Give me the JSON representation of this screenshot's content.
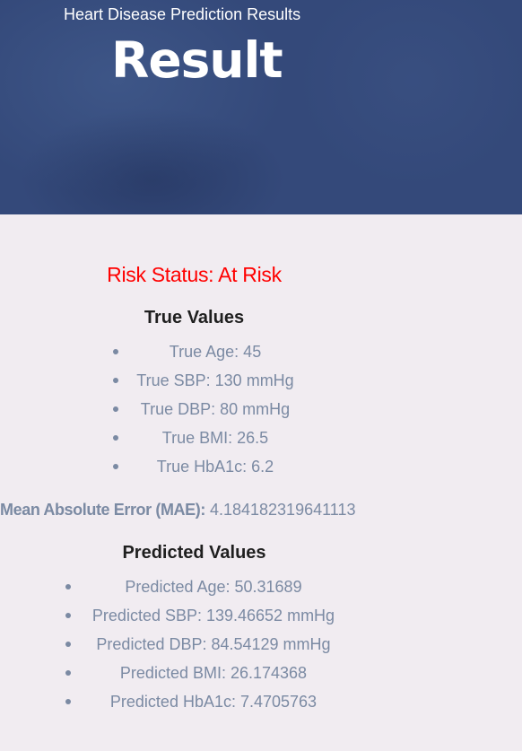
{
  "header": {
    "subtitle": "Heart Disease Prediction Results",
    "title": "Result"
  },
  "risk_status": "Risk Status: At Risk",
  "true_values": {
    "heading": "True Values",
    "items": [
      "True Age: 45",
      "True SBP: 130 mmHg",
      "True DBP: 80 mmHg",
      "True BMI: 26.5",
      "True HbA1c: 6.2"
    ]
  },
  "mae": {
    "label": "Mean Absolute Error (MAE):",
    "value": "4.184182319641113"
  },
  "predicted_values": {
    "heading": "Predicted Values",
    "items": [
      "Predicted Age: 50.31689",
      "Predicted SBP: 139.46652 mmHg",
      "Predicted DBP: 84.54129 mmHg",
      "Predicted BMI: 26.174368",
      "Predicted HbA1c: 7.4705763"
    ]
  },
  "colors": {
    "header_bg": "#34497a",
    "page_bg": "#f1ecf1",
    "risk_text": "#ff0000",
    "body_text": "#7b8aa3",
    "heading_text": "#1f1f1f"
  }
}
